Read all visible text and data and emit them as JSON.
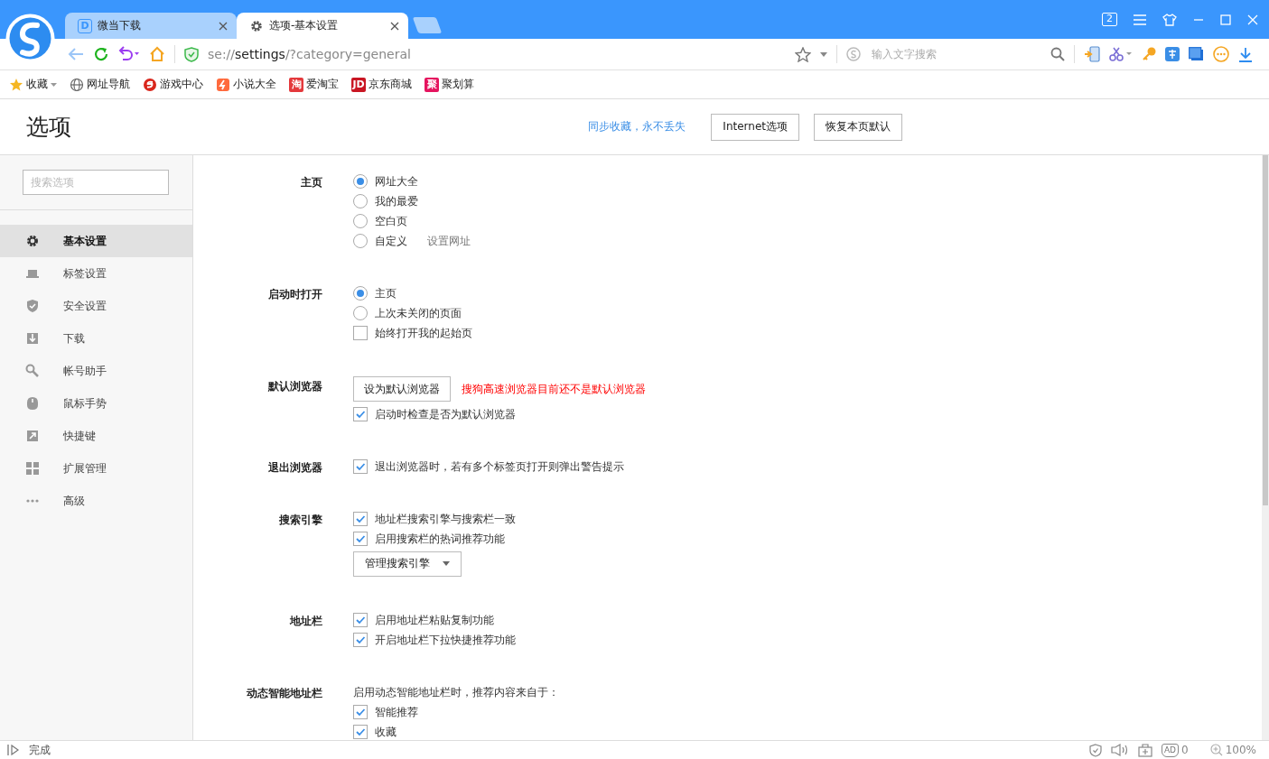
{
  "title_bar": {
    "tabs": [
      {
        "title": "微当下载",
        "icon_text": "D",
        "selected": false
      },
      {
        "title": "选项-基本设置",
        "selected": true
      }
    ],
    "tab_count": "2"
  },
  "toolbar": {
    "url": "se://**settings**/?category=general",
    "search": {
      "placeholder": "输入文字搜索"
    }
  },
  "bookmarks": [
    {
      "label": "收藏",
      "kind": "favorites"
    },
    {
      "label": "网址导航",
      "kind": "globe"
    },
    {
      "label": "游戏中心",
      "kind": "game"
    },
    {
      "label": "小说大全",
      "kind": "novel"
    },
    {
      "label": "爱淘宝",
      "kind": "badge",
      "icon_text": "淘",
      "color": "#e4393c"
    },
    {
      "label": "京东商城",
      "kind": "badge",
      "icon_text": "JD",
      "color": "#c91623"
    },
    {
      "label": "聚划算",
      "kind": "badge",
      "icon_text": "聚",
      "color": "#e5145f"
    }
  ],
  "header": {
    "title": "选项",
    "sync_link": "同步收藏，永不丢失",
    "buttons": [
      "Internet选项",
      "恢复本页默认"
    ]
  },
  "sidebar": {
    "search": {
      "placeholder": "搜索选项"
    },
    "items": [
      {
        "label": "基本设置",
        "selected": true
      },
      {
        "label": "标签设置",
        "selected": false
      },
      {
        "label": "安全设置",
        "selected": false
      },
      {
        "label": "下载",
        "selected": false
      },
      {
        "label": "帐号助手",
        "selected": false
      },
      {
        "label": "鼠标手势",
        "selected": false
      },
      {
        "label": "快捷键",
        "selected": false
      },
      {
        "label": "扩展管理",
        "selected": false
      },
      {
        "label": "高级",
        "selected": false
      }
    ]
  },
  "sections": [
    {
      "label": "主页",
      "rows": [
        {
          "kind": "radio",
          "label": "网址大全",
          "selected": true
        },
        {
          "kind": "radio",
          "label": "我的最爱",
          "selected": false
        },
        {
          "kind": "radio",
          "label": "空白页",
          "selected": false
        },
        {
          "kind": "radio",
          "label": "自定义",
          "selected": false,
          "link": "设置网址"
        }
      ]
    },
    {
      "label": "启动时打开",
      "rows": [
        {
          "kind": "radio",
          "label": "主页",
          "selected": true
        },
        {
          "kind": "radio",
          "label": "上次未关闭的页面",
          "selected": false
        },
        {
          "kind": "checkbox",
          "label": "始终打开我的起始页",
          "checked": false
        }
      ]
    },
    {
      "label": "默认浏览器",
      "rows": [
        {
          "kind": "button",
          "label": "设为默认浏览器",
          "warning": "搜狗高速浏览器目前还不是默认浏览器"
        },
        {
          "kind": "checkbox",
          "label": "启动时检查是否为默认浏览器",
          "checked": true
        }
      ]
    },
    {
      "label": "退出浏览器",
      "rows": [
        {
          "kind": "checkbox",
          "label": "退出浏览器时，若有多个标签页打开则弹出警告提示",
          "checked": true
        }
      ]
    },
    {
      "label": "搜索引擎",
      "rows": [
        {
          "kind": "checkbox",
          "label": "地址栏搜索引擎与搜索栏一致",
          "checked": true
        },
        {
          "kind": "checkbox",
          "label": "启用搜索栏的热词推荐功能",
          "checked": true
        },
        {
          "kind": "dropdown",
          "label": "管理搜索引擎"
        }
      ]
    },
    {
      "label": "地址栏",
      "rows": [
        {
          "kind": "checkbox",
          "label": "启用地址栏粘贴复制功能",
          "checked": true
        },
        {
          "kind": "checkbox",
          "label": "开启地址栏下拉快捷推荐功能",
          "checked": true
        }
      ]
    },
    {
      "label": "动态智能地址栏",
      "rows": [
        {
          "kind": "text",
          "label": "启用动态智能地址栏时，推荐内容来自于："
        },
        {
          "kind": "checkbox",
          "label": "智能推荐",
          "checked": true
        },
        {
          "kind": "checkbox",
          "label": "收藏",
          "checked": true
        }
      ]
    }
  ],
  "status_bar": {
    "text": "完成",
    "ad_icon_text": "AD",
    "ad_count": "0",
    "zoom": "100%"
  }
}
